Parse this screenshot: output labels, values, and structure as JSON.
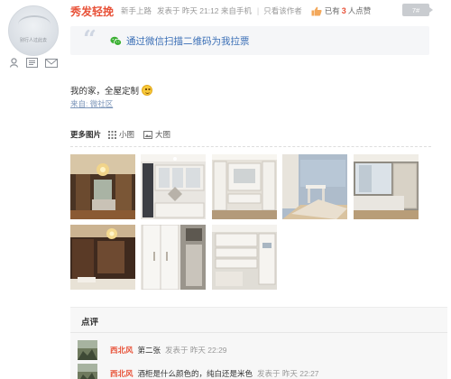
{
  "author": {
    "avatar_caption": "别行人过此去"
  },
  "post": {
    "title": "秀发轻挽",
    "meta_level": "新手上路",
    "meta_time": "发表于 昨天 21:12 来自手机",
    "separator": "|",
    "only_author": "只看该作者",
    "like_prefix": "已有",
    "like_count": "3",
    "like_suffix": "人点赞",
    "floor": "7#",
    "vote_text": "通过微信扫描二维码为我拉票",
    "content": "我的家，全屋定制",
    "source": "来自: 微社区"
  },
  "more_images": {
    "label": "更多图片",
    "small_view": "小图",
    "large_view": "大图",
    "images": [
      {
        "name": "living-room-chandelier",
        "palette": "#7a5a3a"
      },
      {
        "name": "white-cabinets-bar",
        "palette": "#cfc8bd"
      },
      {
        "name": "tv-wall-cabinet",
        "palette": "#dcd6c8"
      },
      {
        "name": "kids-room-desk",
        "palette": "#aab7c6"
      },
      {
        "name": "bedroom-wardrobe",
        "palette": "#8d8a82"
      },
      {
        "name": "dark-wood-room",
        "palette": "#5a3b2a"
      },
      {
        "name": "white-wardrobe",
        "palette": "#d9d4cc"
      },
      {
        "name": "study-bookshelf",
        "palette": "#d2cfc7"
      }
    ]
  },
  "comments": {
    "title": "点评",
    "items": [
      {
        "user": "西北风",
        "text": "第二张",
        "time": "发表于 昨天 22:29"
      },
      {
        "user": "西北风",
        "text": "酒柜是什么颜色的，纯白还是米色",
        "time": "发表于 昨天 22:27"
      }
    ]
  },
  "colors": {
    "accent": "#e8533a",
    "link": "#3b6fb6",
    "wechat": "#3cb034"
  }
}
